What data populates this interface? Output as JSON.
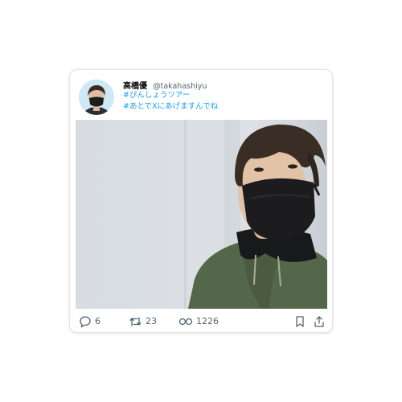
{
  "tweet": {
    "display_name": "高橋優",
    "handle": "@takahashiyu",
    "hashtags": [
      "#ぴんしょうツアー",
      "#あとでXにあげますんでね"
    ]
  },
  "actions": {
    "reply_count": "6",
    "repost_count": "23",
    "view_count": "1226"
  },
  "icons": {
    "reply": "reply-icon",
    "repost": "repost-icon",
    "views": "views-icon",
    "bookmark": "bookmark-icon",
    "share": "share-icon"
  },
  "colors": {
    "hashtag": "#1d9bf0",
    "muted_text": "#536471",
    "jacket": "#55674a"
  }
}
